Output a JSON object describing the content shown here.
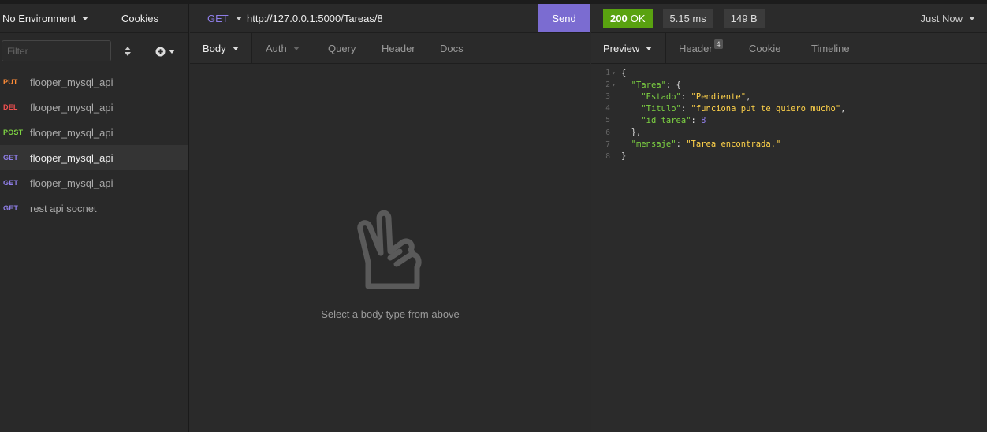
{
  "sidebar": {
    "environment_label": "No Environment",
    "cookies_label": "Cookies",
    "filter_placeholder": "Filter",
    "requests": [
      {
        "method": "PUT",
        "name": "flooper_mysql_api"
      },
      {
        "method": "DEL",
        "name": "flooper_mysql_api"
      },
      {
        "method": "POST",
        "name": "flooper_mysql_api"
      },
      {
        "method": "GET",
        "name": "flooper_mysql_api",
        "active": true
      },
      {
        "method": "GET",
        "name": "flooper_mysql_api"
      },
      {
        "method": "GET",
        "name": "rest api socnet"
      }
    ]
  },
  "request": {
    "method": "GET",
    "url": "http://127.0.0.1:5000/Tareas/8",
    "send_label": "Send",
    "tabs": [
      "Body",
      "Auth",
      "Query",
      "Header",
      "Docs"
    ],
    "empty_text": "Select a body type from above"
  },
  "response": {
    "status_code": "200",
    "status_text": "OK",
    "time": "5.15 ms",
    "size": "149 B",
    "when": "Just Now",
    "tabs": [
      "Preview",
      "Header",
      "Cookie",
      "Timeline"
    ],
    "header_count": "4",
    "body_lines": [
      {
        "n": "1",
        "fold": "▾"
      },
      {
        "n": "2",
        "fold": "▾"
      },
      {
        "n": "3",
        "fold": ""
      },
      {
        "n": "4",
        "fold": ""
      },
      {
        "n": "5",
        "fold": ""
      },
      {
        "n": "6",
        "fold": ""
      },
      {
        "n": "7",
        "fold": ""
      },
      {
        "n": "8",
        "fold": ""
      }
    ],
    "json": {
      "key_tarea": "\"Tarea\"",
      "key_estado": "\"Estado\"",
      "val_estado": "\"Pendiente\"",
      "key_titulo": "\"Titulo\"",
      "val_titulo": "\"funciona put te quiero mucho\"",
      "key_id": "\"id_tarea\"",
      "val_id": "8",
      "key_mensaje": "\"mensaje\"",
      "val_mensaje": "\"Tarea encontrada.\""
    }
  },
  "colors": {
    "accent": "#7b6cd1",
    "status_ok": "#59a210",
    "put": "#ff8c37",
    "del": "#f25050",
    "post": "#7dd242",
    "get": "#8f7ee8"
  }
}
